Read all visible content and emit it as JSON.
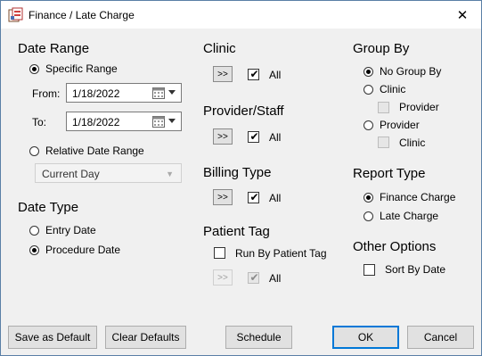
{
  "window": {
    "title": "Finance / Late Charge",
    "close_label": "✕"
  },
  "date_range": {
    "heading": "Date Range",
    "specific_label": "Specific Range",
    "from_label": "From:",
    "from_value": "1/18/2022",
    "to_label": "To:",
    "to_value": "1/18/2022",
    "relative_label": "Relative Date Range",
    "relative_value": "Current Day"
  },
  "date_type": {
    "heading": "Date Type",
    "entry_label": "Entry Date",
    "procedure_label": "Procedure Date",
    "selected": "Procedure Date"
  },
  "clinic": {
    "heading": "Clinic",
    "button": ">>",
    "all_label": "All",
    "all_checked": true
  },
  "provider_staff": {
    "heading": "Provider/Staff",
    "button": ">>",
    "all_label": "All",
    "all_checked": true
  },
  "billing_type": {
    "heading": "Billing Type",
    "button": ">>",
    "all_label": "All",
    "all_checked": true
  },
  "patient_tag": {
    "heading": "Patient Tag",
    "run_by_label": "Run By Patient Tag",
    "run_by_checked": false,
    "button": ">>",
    "all_label": "All",
    "all_checked": true
  },
  "group_by": {
    "heading": "Group By",
    "no_group_label": "No Group By",
    "clinic_label": "Clinic",
    "clinic_provider_label": "Provider",
    "provider_label": "Provider",
    "provider_clinic_label": "Clinic",
    "selected": "No Group By"
  },
  "report_type": {
    "heading": "Report Type",
    "finance_label": "Finance Charge",
    "late_label": "Late Charge",
    "selected": "Finance Charge"
  },
  "other_options": {
    "heading": "Other Options",
    "sort_label": "Sort By Date",
    "sort_checked": false
  },
  "buttons": {
    "save_default": "Save as Default",
    "clear_defaults": "Clear Defaults",
    "schedule": "Schedule",
    "ok": "OK",
    "cancel": "Cancel"
  },
  "icons": {
    "app": "finance-app-icon",
    "calendar": "calendar-icon",
    "close": "close-icon"
  },
  "colors": {
    "accent": "#0078d7",
    "window_bg": "#f0f0f0",
    "border": "#5a7fa6"
  }
}
